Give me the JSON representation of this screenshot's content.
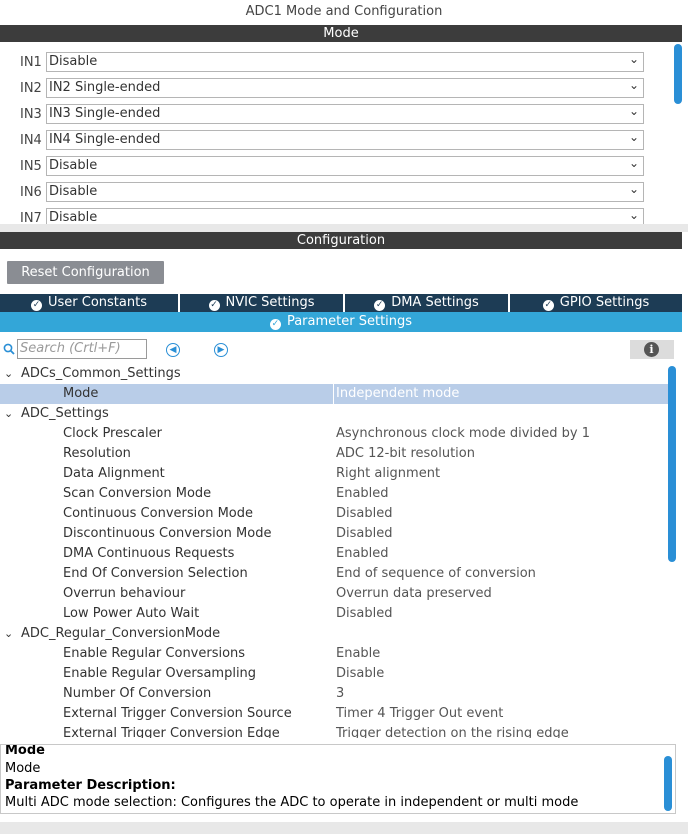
{
  "title": "ADC1 Mode and Configuration",
  "mode_section": {
    "label": "Mode",
    "rows": [
      {
        "label": "IN1",
        "value": "Disable"
      },
      {
        "label": "IN2",
        "value": "IN2 Single-ended"
      },
      {
        "label": "IN3",
        "value": "IN3 Single-ended"
      },
      {
        "label": "IN4",
        "value": "IN4 Single-ended"
      },
      {
        "label": "IN5",
        "value": "Disable"
      },
      {
        "label": "IN6",
        "value": "Disable"
      },
      {
        "label": "IN7",
        "value": "Disable"
      }
    ]
  },
  "config_section": {
    "label": "Configuration",
    "reset_button": "Reset Configuration",
    "tabs": [
      {
        "label": "User Constants"
      },
      {
        "label": "NVIC Settings"
      },
      {
        "label": "DMA Settings"
      },
      {
        "label": "GPIO Settings"
      }
    ],
    "active_tab": "Parameter Settings",
    "search_placeholder": "Search (Crtl+F)"
  },
  "tree": [
    {
      "kind": "group",
      "name": "ADCs_Common_Settings"
    },
    {
      "kind": "param",
      "name": "Mode",
      "value": "Independent mode",
      "selected": true
    },
    {
      "kind": "group",
      "name": "ADC_Settings"
    },
    {
      "kind": "param",
      "name": "Clock Prescaler",
      "value": "Asynchronous clock mode divided by 1"
    },
    {
      "kind": "param",
      "name": "Resolution",
      "value": "ADC 12-bit resolution"
    },
    {
      "kind": "param",
      "name": "Data Alignment",
      "value": "Right alignment"
    },
    {
      "kind": "param",
      "name": "Scan Conversion Mode",
      "value": "Enabled"
    },
    {
      "kind": "param",
      "name": "Continuous Conversion Mode",
      "value": "Disabled"
    },
    {
      "kind": "param",
      "name": "Discontinuous Conversion Mode",
      "value": "Disabled"
    },
    {
      "kind": "param",
      "name": "DMA Continuous Requests",
      "value": "Enabled"
    },
    {
      "kind": "param",
      "name": "End Of Conversion Selection",
      "value": "End of sequence of conversion"
    },
    {
      "kind": "param",
      "name": "Overrun behaviour",
      "value": "Overrun data preserved"
    },
    {
      "kind": "param",
      "name": "Low Power Auto Wait",
      "value": "Disabled"
    },
    {
      "kind": "group",
      "name": "ADC_Regular_ConversionMode"
    },
    {
      "kind": "param",
      "name": "Enable Regular Conversions",
      "value": "Enable"
    },
    {
      "kind": "param",
      "name": "Enable Regular Oversampling",
      "value": "Disable"
    },
    {
      "kind": "param",
      "name": "Number Of Conversion",
      "value": "3"
    },
    {
      "kind": "param",
      "name": "External Trigger Conversion Source",
      "value": "Timer 4 Trigger Out event"
    },
    {
      "kind": "param",
      "name": "External Trigger Conversion Edge",
      "value": "Trigger detection on the rising edge"
    }
  ],
  "description": {
    "header_cut": "Mode",
    "name": "Mode",
    "heading": "Parameter Description:",
    "text": "Multi ADC mode selection: Configures the ADC to operate in independent or multi mode"
  },
  "colors": {
    "dark_bar": "#3c3c3c",
    "tab_bg": "#1d3c55",
    "tab_active_bg": "#33a6d8",
    "scrollbar": "#2a8fd6",
    "selected_row": "#b9cde8"
  }
}
